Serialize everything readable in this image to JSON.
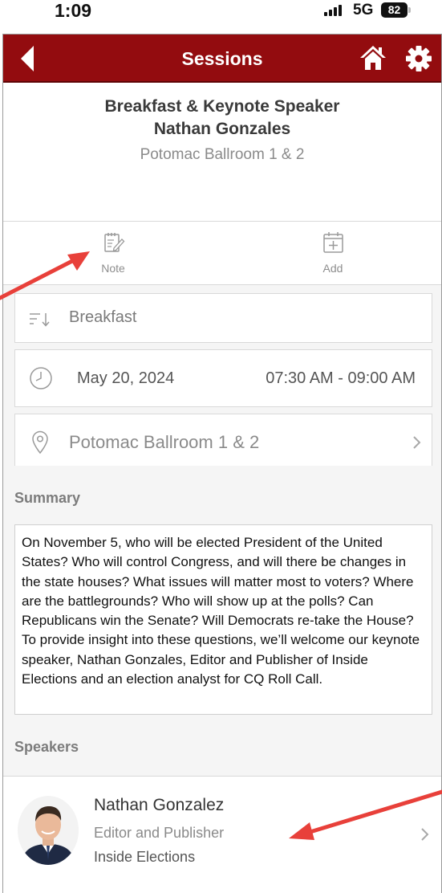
{
  "status_bar": {
    "time": "1:09",
    "network": "5G",
    "battery": "82"
  },
  "header": {
    "title": "Sessions"
  },
  "session": {
    "title_line1": "Breakfast & Keynote Speaker",
    "title_line2": "Nathan Gonzales",
    "location": "Potomac Ballroom 1 & 2"
  },
  "actions": [
    {
      "label": "Note",
      "icon": "note-edit-icon"
    },
    {
      "label": "Add",
      "icon": "calendar-add-icon"
    }
  ],
  "details": {
    "category": "Breakfast",
    "date": "May 20, 2024",
    "time_range": "07:30 AM - 09:00 AM",
    "location": "Potomac Ballroom 1 & 2"
  },
  "summary": {
    "label": "Summary",
    "text": "On November 5, who will be elected President of the United States? Who will control Congress, and will there be changes in the state houses? What issues will matter most to voters? Where are the battlegrounds? Who will show up at the polls? Can Republicans win the Senate?  Will Democrats re-take the House? To provide insight into these questions, we’ll welcome our keynote speaker, Nathan Gonzales, Editor and Publisher of Inside Elections and an election analyst for CQ Roll Call."
  },
  "speakers": {
    "label": "Speakers",
    "items": [
      {
        "name": "Nathan Gonzalez",
        "title": "Editor and Publisher",
        "organization": "Inside Elections"
      }
    ]
  },
  "colors": {
    "header": "#930c0f",
    "annotation_arrow": "#e8403a"
  }
}
